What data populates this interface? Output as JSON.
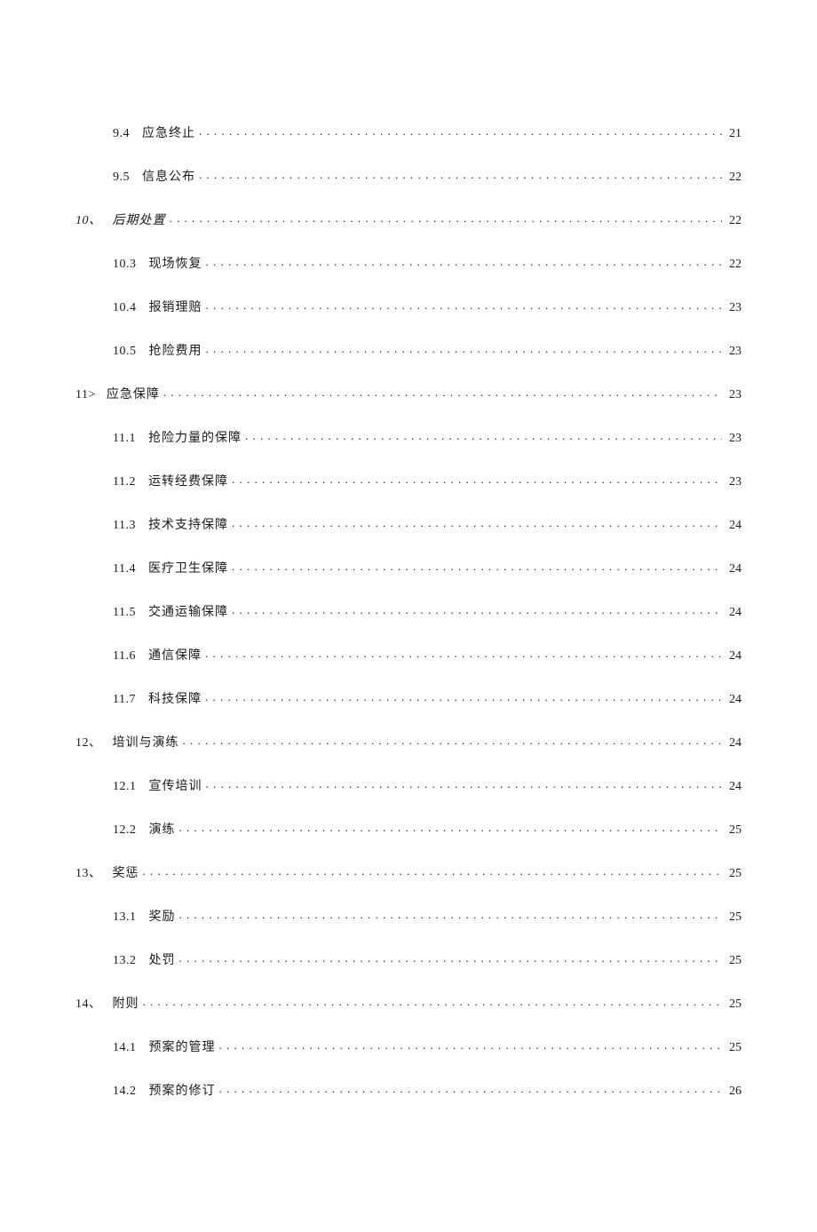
{
  "toc": [
    {
      "level": "sub",
      "num": "9.4",
      "title": "应急终止",
      "page": "21",
      "italic": false
    },
    {
      "level": "sub",
      "num": "9.5",
      "title": "信息公布",
      "page": "22",
      "italic": false
    },
    {
      "level": "section",
      "num": "10、",
      "title": "后期处置",
      "page": "22",
      "italic": true
    },
    {
      "level": "sub",
      "num": "10.3",
      "title": "现场恢复",
      "page": "22",
      "italic": false
    },
    {
      "level": "sub",
      "num": "10.4",
      "title": "报销理赔",
      "page": "23",
      "italic": false
    },
    {
      "level": "sub",
      "num": "10.5",
      "title": "抢险费用",
      "page": "23",
      "italic": false
    },
    {
      "level": "section",
      "num": "11>",
      "title": "应急保障",
      "page": "23",
      "italic": false
    },
    {
      "level": "sub",
      "num": "11.1",
      "title": "抢险力量的保障",
      "page": "23",
      "italic": false
    },
    {
      "level": "sub",
      "num": "11.2",
      "title": "运转经费保障",
      "page": "23",
      "italic": false
    },
    {
      "level": "sub",
      "num": "11.3",
      "title": "技术支持保障",
      "page": "24",
      "italic": false
    },
    {
      "level": "sub",
      "num": "11.4",
      "title": "医疗卫生保障",
      "page": "24",
      "italic": false
    },
    {
      "level": "sub",
      "num": "11.5",
      "title": "交通运输保障",
      "page": "24",
      "italic": false
    },
    {
      "level": "sub",
      "num": "11.6",
      "title": "通信保障",
      "page": "24",
      "italic": false
    },
    {
      "level": "sub",
      "num": "11.7",
      "title": "科技保障",
      "page": "24",
      "italic": false
    },
    {
      "level": "section",
      "num": "12、",
      "title": "培训与演练",
      "page": "24",
      "italic": false
    },
    {
      "level": "sub",
      "num": "12.1",
      "title": "宣传培训",
      "page": "24",
      "italic": false
    },
    {
      "level": "sub",
      "num": "12.2",
      "title": "演练",
      "page": "25",
      "italic": false
    },
    {
      "level": "section",
      "num": "13、",
      "title": "奖惩",
      "page": "25",
      "italic": false
    },
    {
      "level": "sub",
      "num": "13.1",
      "title": "奖励",
      "page": "25",
      "italic": false
    },
    {
      "level": "sub",
      "num": "13.2",
      "title": "处罚",
      "page": "25",
      "italic": false
    },
    {
      "level": "section",
      "num": "14、",
      "title": "附则",
      "page": "25",
      "italic": false
    },
    {
      "level": "sub",
      "num": "14.1",
      "title": "预案的管理",
      "page": "25",
      "italic": false
    },
    {
      "level": "sub",
      "num": "14.2",
      "title": "预案的修订",
      "page": "26",
      "italic": false
    }
  ]
}
